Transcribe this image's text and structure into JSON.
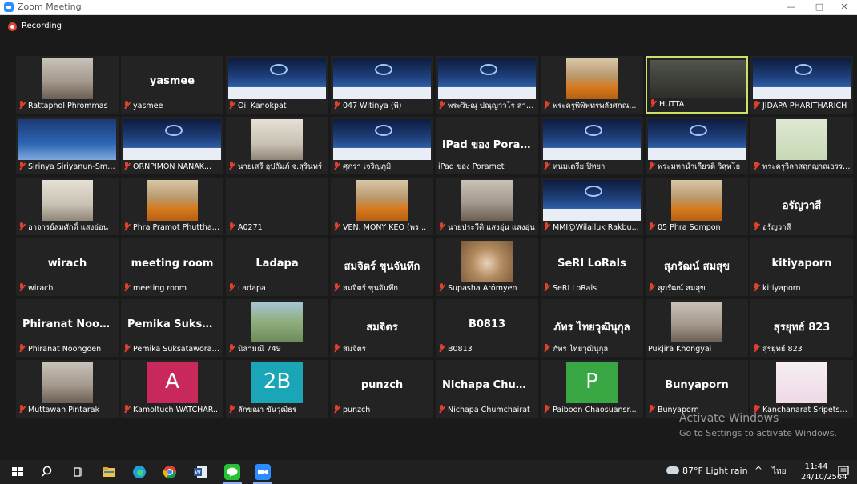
{
  "window": {
    "title": "Zoom Meeting",
    "minimize": "—",
    "maximize": "□",
    "close": "✕"
  },
  "recording": {
    "label": "Recording"
  },
  "participants": [
    {
      "name": "Rattaphol Phrommas",
      "big": "",
      "video": "person",
      "muted": true
    },
    {
      "name": "yasmee",
      "big": "yasmee",
      "video": "",
      "muted": true
    },
    {
      "name": "Oil Kanokpat",
      "big": "",
      "video": "slide",
      "muted": true
    },
    {
      "name": "047 Witinya (พี)",
      "big": "",
      "video": "slide",
      "muted": true
    },
    {
      "name": "พระวิษณุ ปณฺญาวโร สาย...",
      "big": "",
      "video": "slide",
      "muted": true
    },
    {
      "name": "พระครูพิพิพทรพลังศกณ...",
      "big": "",
      "video": "monk",
      "muted": true
    },
    {
      "name": "HUTTA",
      "big": "",
      "video": "dark",
      "muted": true,
      "active": true
    },
    {
      "name": "JIDAPA PHARITHARICH",
      "big": "",
      "video": "slide",
      "muted": true
    },
    {
      "name": "Sirinya Siriyanun-Smith",
      "big": "",
      "video": "map",
      "muted": true
    },
    {
      "name": "ORNPIMON NANAK...",
      "big": "",
      "video": "slide",
      "muted": true
    },
    {
      "name": "นายเสรี อุปถัมภ์ จ.สุรินทร์",
      "big": "",
      "video": "room",
      "muted": true
    },
    {
      "name": "ศุภรา เจริญภูมิ",
      "big": "",
      "video": "slide",
      "muted": true
    },
    {
      "name": "iPad ของ Poramet",
      "big": "iPad ของ Poramet",
      "video": "",
      "muted": false
    },
    {
      "name": "หนมเตรีย ปิทยา",
      "big": "",
      "video": "slide",
      "muted": true
    },
    {
      "name": "พระมหานำเกียรติ วิสุทโธ",
      "big": "",
      "video": "slide",
      "muted": true
    },
    {
      "name": "พระครูวิลาสฤกญาณธรรม...",
      "big": "",
      "video": "green",
      "muted": true
    },
    {
      "name": "อาจารย์สมศักดิ์ แสงอ่อน",
      "big": "",
      "video": "room",
      "muted": true
    },
    {
      "name": "Phra Pramot Phutthat...",
      "big": "",
      "video": "monk",
      "muted": true
    },
    {
      "name": "A0271",
      "big": "",
      "video": "",
      "muted": true
    },
    {
      "name": "VEN. MONY KEO (พร...",
      "big": "",
      "video": "monk",
      "muted": true
    },
    {
      "name": "นายประวีติ แสงอุ่น แสงอุ่น",
      "big": "",
      "video": "person",
      "muted": true
    },
    {
      "name": "MMI@Wilailuk Rakbu...",
      "big": "",
      "video": "slide",
      "muted": true
    },
    {
      "name": "05 Phra Sompon",
      "big": "",
      "video": "monk",
      "muted": true
    },
    {
      "name": "อรัญวาสี",
      "big": "อรัญวาสี",
      "video": "",
      "muted": true
    },
    {
      "name": "wirach",
      "big": "wirach",
      "video": "",
      "muted": true
    },
    {
      "name": "meeting room",
      "big": "meeting room",
      "video": "",
      "muted": true
    },
    {
      "name": "Ladapa",
      "big": "Ladapa",
      "video": "",
      "muted": true
    },
    {
      "name": "สมจิตร์ ขุนจันทึก",
      "big": "สมจิตร์ ขุนจันทึก",
      "video": "",
      "muted": true
    },
    {
      "name": "Supasha Arómyen",
      "big": "",
      "video": "hedgehog",
      "muted": true
    },
    {
      "name": "SeRI LoRals",
      "big": "SeRI LoRals",
      "video": "",
      "muted": true
    },
    {
      "name": "สุภรัฒน์ สมสุข",
      "big": "สุภรัฒน์ สมสุข",
      "video": "",
      "muted": true
    },
    {
      "name": "kitiyaporn",
      "big": "kitiyaporn",
      "video": "",
      "muted": true
    },
    {
      "name": "Phiranat Noongoen",
      "big": "Phiranat Noong...",
      "video": "",
      "muted": true
    },
    {
      "name": "Pemika Suksataworap...",
      "big": "Pemika Suksata...",
      "video": "",
      "muted": true
    },
    {
      "name": "นิสามณี 749",
      "big": "",
      "video": "outdoor",
      "muted": true
    },
    {
      "name": "สมจิตร",
      "big": "สมจิตร",
      "video": "",
      "muted": true
    },
    {
      "name": "B0813",
      "big": "B0813",
      "video": "",
      "muted": true
    },
    {
      "name": "ภัทร ไทยวุฒินุกุล",
      "big": "ภัทร ไทยวุฒินุกุล",
      "video": "",
      "muted": true
    },
    {
      "name": "Pukjira Khongyai",
      "big": "",
      "video": "person",
      "muted": false
    },
    {
      "name": "สุรยุทธ์ 823",
      "big": "สุรยุทธ์ 823",
      "video": "",
      "muted": true
    },
    {
      "name": "Muttawan Pintarak",
      "big": "",
      "video": "person",
      "muted": true
    },
    {
      "name": "Kamoltuch WATCHAR...",
      "big": "",
      "video": "avatarA",
      "avatar": "A",
      "muted": true
    },
    {
      "name": "ลักขณา ขันวุฒิธร",
      "big": "",
      "video": "avatar2B",
      "avatar": "2B",
      "muted": true
    },
    {
      "name": "punzch",
      "big": "punzch",
      "video": "",
      "muted": true
    },
    {
      "name": "Nichapa Chumchairat",
      "big": "Nichapa Chumc...",
      "video": "",
      "muted": true
    },
    {
      "name": "Paiboon Chaosuansr...",
      "big": "",
      "video": "avatarP",
      "avatar": "P",
      "muted": true
    },
    {
      "name": "Bunyaporn",
      "big": "Bunyaporn",
      "video": "",
      "muted": true
    },
    {
      "name": "Kanchanarat Sripetsu...",
      "big": "",
      "video": "light",
      "muted": true
    }
  ],
  "activation": {
    "line1": "Activate Windows",
    "line2": "Go to Settings to activate Windows."
  },
  "taskbar": {
    "weather": "87°F  Light rain",
    "lang": "ไทย",
    "time": "11:44",
    "date": "24/10/2564",
    "colors": {
      "zoom": "#2d8cff",
      "line": "#27c233",
      "word": "#2b5797",
      "edge": "#1ea0d8",
      "explorer": "#f4c23f"
    }
  }
}
